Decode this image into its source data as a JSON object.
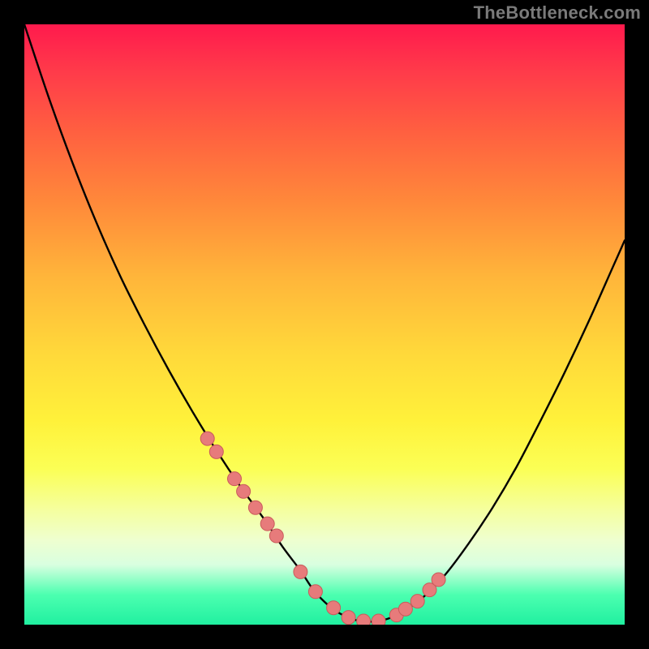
{
  "watermark": "TheBottleneck.com",
  "colors": {
    "curve": "#000000",
    "marker_fill": "#e77b7b",
    "marker_stroke": "#c95b5b",
    "gradient_top": "#ff1a4d",
    "gradient_bottom": "#20f0a0"
  },
  "chart_data": {
    "type": "line",
    "title": "",
    "xlabel": "",
    "ylabel": "",
    "xlim": [
      0,
      100
    ],
    "ylim": [
      0,
      100
    ],
    "grid": false,
    "series": [
      {
        "name": "bottleneck-curve",
        "x": [
          0,
          4,
          8,
          12,
          16,
          20,
          24,
          28,
          32,
          36,
          40,
          43,
          46,
          48,
          50,
          52,
          54,
          56,
          59,
          62,
          66,
          70,
          74,
          78,
          82,
          86,
          90,
          94,
          98,
          100
        ],
        "y": [
          100,
          88,
          77,
          67,
          58,
          50,
          42.5,
          35.5,
          29,
          23,
          17.5,
          13,
          9,
          6,
          3.8,
          2.2,
          1.2,
          0.6,
          0.6,
          1.6,
          4.2,
          8.2,
          13.5,
          19.5,
          26.3,
          34,
          42,
          50.5,
          59.5,
          64
        ]
      }
    ],
    "markers": {
      "name": "highlight-points",
      "x": [
        30.5,
        32.0,
        35.0,
        36.5,
        38.5,
        40.5,
        42.0,
        46.0,
        48.5,
        51.5,
        54.0,
        56.5,
        59.0,
        62.0,
        63.5,
        65.5,
        67.5,
        69.0
      ],
      "y": [
        31.0,
        28.8,
        24.3,
        22.2,
        19.5,
        16.8,
        14.8,
        8.8,
        5.5,
        2.8,
        1.2,
        0.6,
        0.6,
        1.6,
        2.6,
        3.9,
        5.8,
        7.5
      ]
    }
  }
}
